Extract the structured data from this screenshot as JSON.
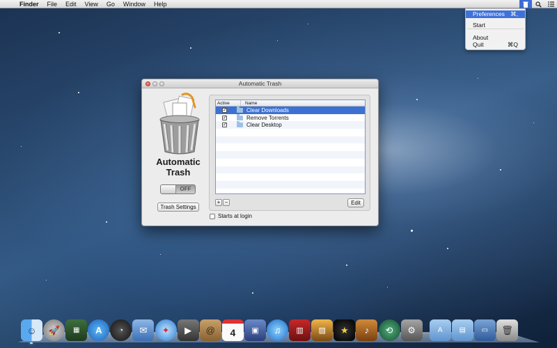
{
  "menubar": {
    "app_name": "Finder",
    "menus": [
      "File",
      "Edit",
      "View",
      "Go",
      "Window",
      "Help"
    ],
    "status_icons": [
      "automatic-trash-icon",
      "spotlight-search-icon",
      "notification-center-icon"
    ]
  },
  "status_menu": {
    "items": [
      {
        "label": "Preferences",
        "shortcut": "⌘,",
        "highlighted": true
      },
      {
        "label": "Start",
        "shortcut": ""
      },
      {
        "label": "About",
        "shortcut": ""
      },
      {
        "label": "Quit",
        "shortcut": "⌘Q"
      }
    ]
  },
  "window": {
    "title": "Automatic Trash",
    "app_name_line1": "Automatic",
    "app_name_line2": "Trash",
    "toggle_label": "OFF",
    "settings_button": "Trash Settings",
    "table": {
      "headers": {
        "active": "Active",
        "name": "Name"
      },
      "rows": [
        {
          "active": true,
          "name": "Clear Downloads",
          "selected": true
        },
        {
          "active": true,
          "name": "Remove Torrents",
          "selected": false
        },
        {
          "active": true,
          "name": "Clear Desktop",
          "selected": false
        }
      ]
    },
    "add_label": "+",
    "remove_label": "−",
    "edit_button": "Edit",
    "login_label": "Starts at login"
  },
  "dock": {
    "items": [
      "finder-icon",
      "launchpad-icon",
      "mission-control-icon",
      "app-store-icon",
      "dashboard-icon",
      "mail-icon",
      "safari-icon",
      "facetime-icon",
      "contacts-icon",
      "calendar-icon",
      "photo-booth-icon",
      "itunes-icon",
      "photo-app-icon",
      "iphoto-icon",
      "imovie-icon",
      "garageband-icon",
      "time-machine-icon",
      "system-preferences-icon",
      "applications-folder-icon",
      "documents-folder-icon",
      "downloads-stack-icon",
      "trash-icon"
    ],
    "calendar_day": "4"
  },
  "colors": {
    "selection": "#3c71d3",
    "menu_highlight": "#3f72d9",
    "desktop": "#2c4d74"
  }
}
